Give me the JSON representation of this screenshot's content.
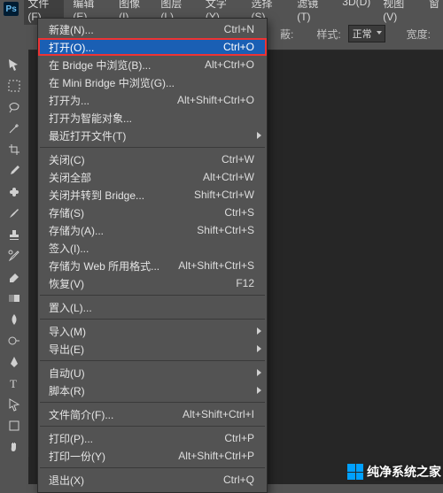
{
  "menubar": {
    "logo": "Ps",
    "items": [
      {
        "label": "文件(F)",
        "name": "menu-file",
        "active": true
      },
      {
        "label": "编辑(E)",
        "name": "menu-edit"
      },
      {
        "label": "图像(I)",
        "name": "menu-image"
      },
      {
        "label": "图层(L)",
        "name": "menu-layer"
      },
      {
        "label": "文字(Y)",
        "name": "menu-type"
      },
      {
        "label": "选择(S)",
        "name": "menu-select"
      },
      {
        "label": "滤镜(T)",
        "name": "menu-filter"
      },
      {
        "label": "3D(D)",
        "name": "menu-3d"
      },
      {
        "label": "视图(V)",
        "name": "menu-view"
      },
      {
        "label": "窗",
        "name": "menu-window-truncated"
      }
    ]
  },
  "options_bar": {
    "mask_trunc": "蔽:",
    "style_label": "样式:",
    "style_value": "正常",
    "width_label": "宽度:"
  },
  "dropdown": {
    "items": [
      {
        "label": "新建(N)...",
        "shortcut": "Ctrl+N"
      },
      {
        "label": "打开(O)...",
        "shortcut": "Ctrl+O",
        "highlight": true,
        "redbox": true
      },
      {
        "label": "在 Bridge 中浏览(B)...",
        "shortcut": "Alt+Ctrl+O"
      },
      {
        "label": "在 Mini Bridge 中浏览(G)..."
      },
      {
        "label": "打开为...",
        "shortcut": "Alt+Shift+Ctrl+O"
      },
      {
        "label": "打开为智能对象..."
      },
      {
        "label": "最近打开文件(T)",
        "submenu": true
      },
      {
        "sep": true
      },
      {
        "label": "关闭(C)",
        "shortcut": "Ctrl+W"
      },
      {
        "label": "关闭全部",
        "shortcut": "Alt+Ctrl+W"
      },
      {
        "label": "关闭并转到 Bridge...",
        "shortcut": "Shift+Ctrl+W"
      },
      {
        "label": "存储(S)",
        "shortcut": "Ctrl+S"
      },
      {
        "label": "存储为(A)...",
        "shortcut": "Shift+Ctrl+S"
      },
      {
        "label": "签入(I)..."
      },
      {
        "label": "存储为 Web 所用格式...",
        "shortcut": "Alt+Shift+Ctrl+S"
      },
      {
        "label": "恢复(V)",
        "shortcut": "F12"
      },
      {
        "sep": true
      },
      {
        "label": "置入(L)..."
      },
      {
        "sep": true
      },
      {
        "label": "导入(M)",
        "submenu": true
      },
      {
        "label": "导出(E)",
        "submenu": true
      },
      {
        "sep": true
      },
      {
        "label": "自动(U)",
        "submenu": true
      },
      {
        "label": "脚本(R)",
        "submenu": true
      },
      {
        "sep": true
      },
      {
        "label": "文件简介(F)...",
        "shortcut": "Alt+Shift+Ctrl+I"
      },
      {
        "sep": true
      },
      {
        "label": "打印(P)...",
        "shortcut": "Ctrl+P"
      },
      {
        "label": "打印一份(Y)",
        "shortcut": "Alt+Shift+Ctrl+P"
      },
      {
        "sep": true
      },
      {
        "label": "退出(X)",
        "shortcut": "Ctrl+Q"
      }
    ]
  },
  "watermark": {
    "text": "纯净系统之家"
  }
}
